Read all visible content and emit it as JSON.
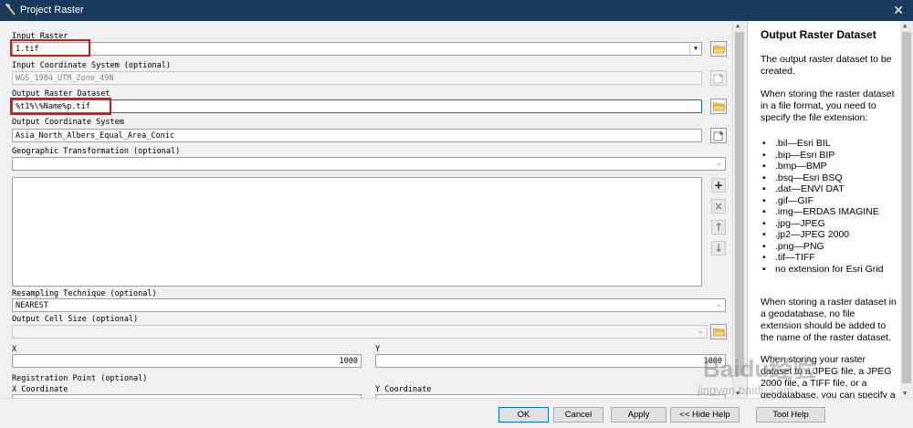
{
  "window": {
    "title": "Project Raster",
    "close_glyph": "✕"
  },
  "form": {
    "input_raster": {
      "label": "Input Raster",
      "value": "1.tif"
    },
    "input_coord_system": {
      "label": "Input Coordinate System (optional)",
      "value": "WGS_1984_UTM_Zone_49N"
    },
    "output_raster": {
      "label": "Output Raster Dataset",
      "value": "%t1%\\%Name%p.tif"
    },
    "output_coord_system": {
      "label": "Output Coordinate System",
      "value": "Asia_North_Albers_Equal_Area_Conic"
    },
    "geo_transform": {
      "label": "Geographic Transformation (optional)",
      "value": ""
    },
    "resampling": {
      "label": "Resampling Technique (optional)",
      "value": "NEAREST"
    },
    "cell_size": {
      "label": "Output Cell Size (optional)",
      "value": ""
    },
    "x": {
      "label": "X",
      "value": "1000"
    },
    "y": {
      "label": "Y",
      "value": "1000"
    },
    "registration": {
      "label": "Registration Point (optional)"
    },
    "x_coord": {
      "label": "X Coordinate"
    },
    "y_coord": {
      "label": "Y Coordinate"
    }
  },
  "list_buttons": {
    "add": "+",
    "remove": "×",
    "up": "↑",
    "down": "↓"
  },
  "help": {
    "title": "Output Raster Dataset",
    "p1": "The output raster dataset to be created.",
    "p2": "When storing the raster dataset in a file format, you need to specify the file extension:",
    "extensions": [
      ".bil—Esri BIL",
      ".bip—Esri BIP",
      ".bmp—BMP",
      ".bsq—Esri BSQ",
      ".dat—ENVI DAT",
      ".gif—GIF",
      ".img—ERDAS IMAGINE",
      ".jpg—JPEG",
      ".jp2—JPEG 2000",
      ".png—PNG",
      ".tif—TIFF",
      "no extension for Esri Grid"
    ],
    "p3": "When storing a raster dataset in a geodatabase, no file extension should be added to the name of the raster dataset.",
    "p4": "When storing your raster dataset to a JPEG file, a JPEG 2000 file, a TIFF file, or a geodatabase, you can specify a Compression"
  },
  "buttons": {
    "ok": "OK",
    "cancel": "Cancel",
    "apply": "Apply",
    "hide_help": "<< Hide Help",
    "tool_help": "Tool Help"
  },
  "watermark": {
    "brand": "Baidu经验",
    "url": "jingyan.baidu.com"
  },
  "colors": {
    "titlebar": "#1a3a5c",
    "highlight": "#d01a1a",
    "default_border": "#0078d7"
  }
}
